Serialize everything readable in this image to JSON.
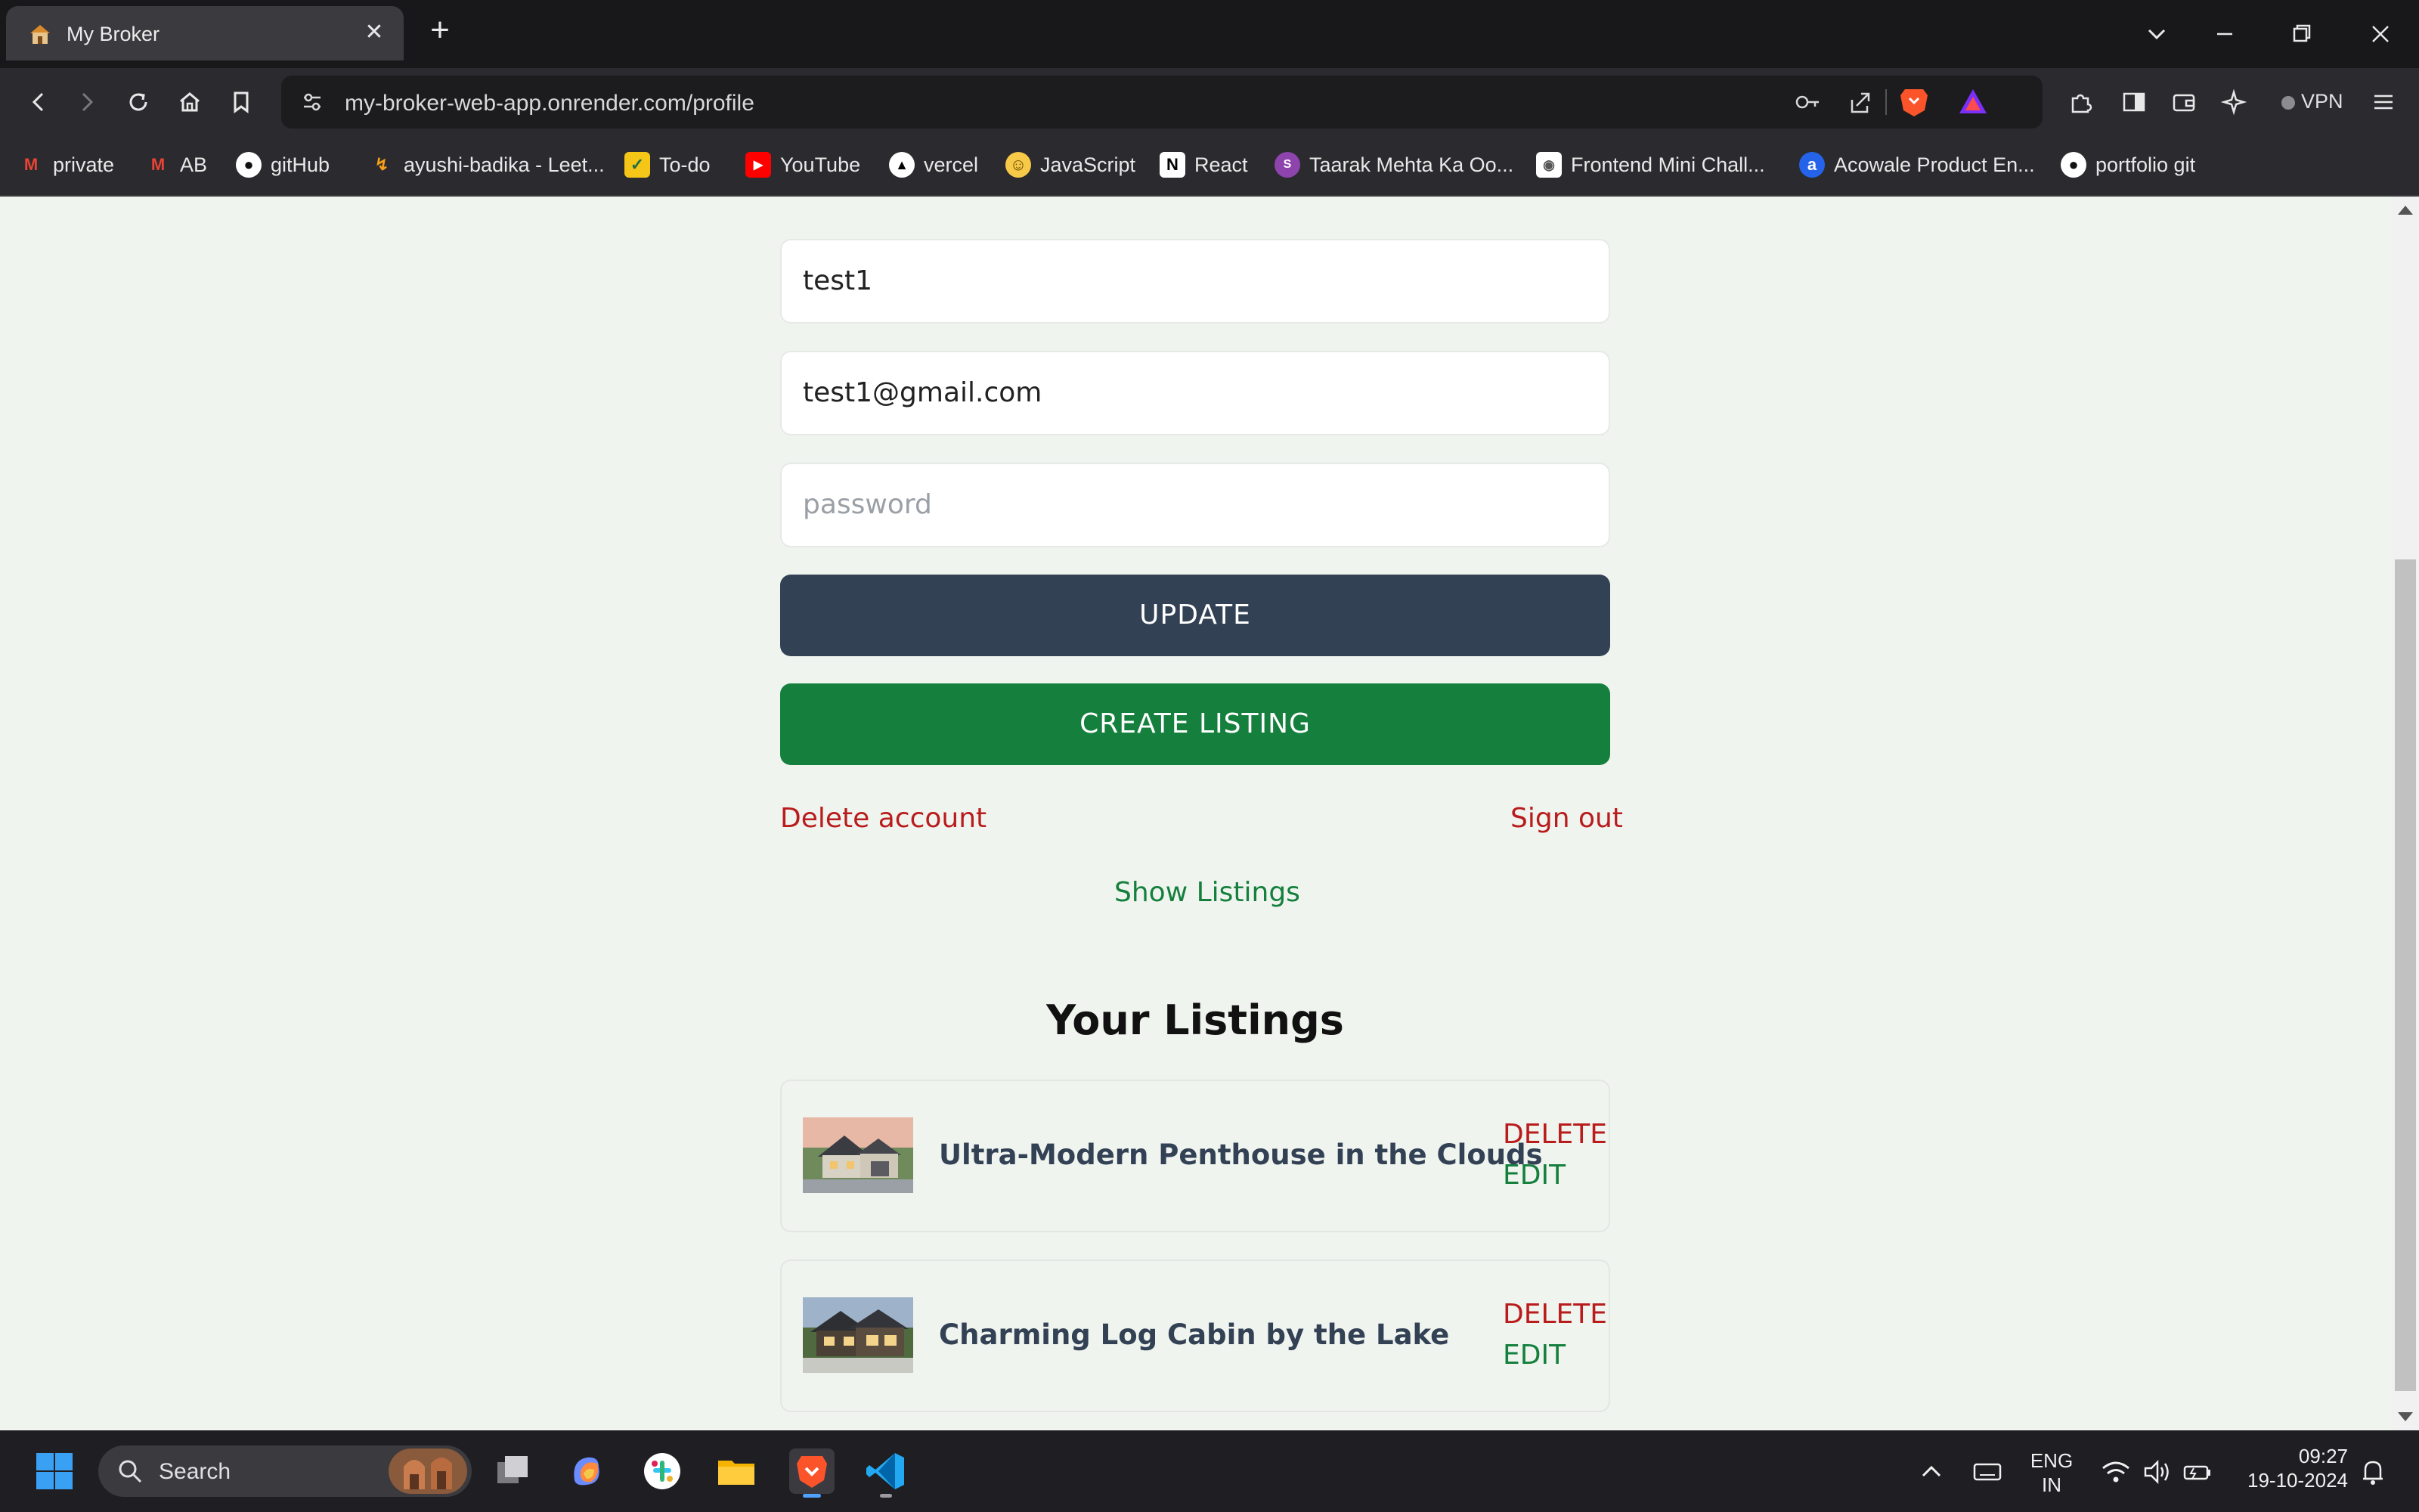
{
  "browser": {
    "tab_title": "My Broker",
    "url": "my-broker-web-app.onrender.com/profile",
    "vpn_label": "VPN",
    "bookmarks": [
      {
        "label": "private",
        "icon": "gmail-icon",
        "color": "#ea4335"
      },
      {
        "label": "AB",
        "icon": "gmail-icon",
        "color": "#ea4335"
      },
      {
        "label": "gitHub",
        "icon": "github-icon",
        "color": "#ffffff"
      },
      {
        "label": "ayushi-badika - Leet...",
        "icon": "leetcode-icon",
        "color": "#f89f1b"
      },
      {
        "label": "To-do",
        "icon": "todo-icon",
        "color": "#f5c518"
      },
      {
        "label": "YouTube",
        "icon": "youtube-icon",
        "color": "#ff0000"
      },
      {
        "label": "vercel",
        "icon": "vercel-icon",
        "color": "#ffffff"
      },
      {
        "label": "JavaScript",
        "icon": "emoji-icon",
        "color": "#f7c948"
      },
      {
        "label": "React",
        "icon": "notion-icon",
        "color": "#ffffff"
      },
      {
        "label": "Taarak Mehta Ka Oo...",
        "icon": "sonyliv-icon",
        "color": "#8e44ad"
      },
      {
        "label": "Frontend Mini Chall...",
        "icon": "frontend-icon",
        "color": "#ffffff"
      },
      {
        "label": "Acowale Product En...",
        "icon": "acowale-icon",
        "color": "#2563eb"
      },
      {
        "label": "portfolio git",
        "icon": "github-icon",
        "color": "#ffffff"
      }
    ]
  },
  "profile": {
    "username": "test1",
    "email": "test1@gmail.com",
    "password_placeholder": "password",
    "update_label": "UPDATE",
    "create_listing_label": "CREATE LISTING",
    "delete_account_label": "Delete account",
    "sign_out_label": "Sign out",
    "show_listings_label": "Show Listings"
  },
  "listings": {
    "heading": "Your Listings",
    "items": [
      {
        "title": "Ultra-Modern Penthouse in the Clouds",
        "delete_label": "DELETE",
        "edit_label": "EDIT"
      },
      {
        "title": "Charming Log Cabin by the Lake",
        "delete_label": "DELETE",
        "edit_label": "EDIT"
      }
    ]
  },
  "taskbar": {
    "search_label": "Search",
    "language_top": "ENG",
    "language_bottom": "IN",
    "time": "09:27",
    "date": "19-10-2024"
  },
  "colors": {
    "page_bg": "#f0f4ef",
    "update_button": "#334155",
    "create_button": "#15803d",
    "danger": "#b91c1c",
    "success": "#15803d"
  }
}
